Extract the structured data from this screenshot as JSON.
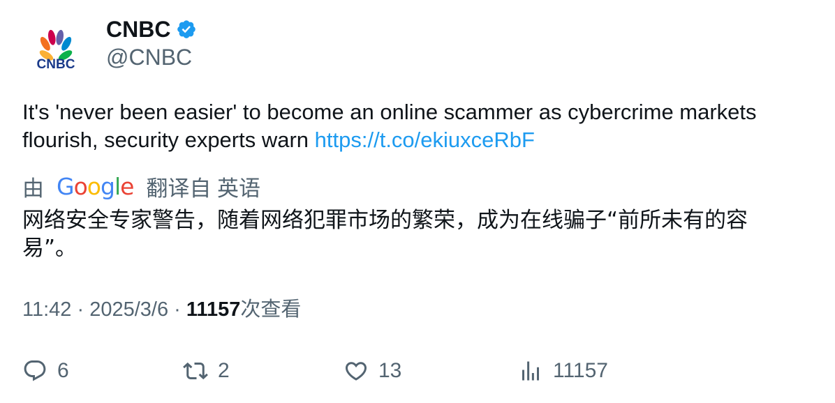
{
  "author": {
    "display_name": "CNBC",
    "handle": "@CNBC",
    "avatar_text": "CNBC",
    "verified": true,
    "avatar_colors": [
      "#fbb034",
      "#f37021",
      "#cc004c",
      "#6460aa",
      "#0089d0",
      "#0db14b"
    ]
  },
  "tweet": {
    "text": "It's 'never been easier' to become an online scammer as cybercrime markets flourish, security experts warn ",
    "link": "https://t.co/ekiuxceRbF"
  },
  "translation": {
    "prefix": "由",
    "provider": "Google",
    "suffix": "翻译自 英语",
    "text": "网络安全专家警告，随着网络犯罪市场的繁荣，成为在线骗子“前所未有的容易”。"
  },
  "meta": {
    "time": "11:42",
    "separator": "·",
    "date": "2025/3/6",
    "views_count": "11157",
    "views_label": "次查看"
  },
  "actions": {
    "replies": "6",
    "retweets": "2",
    "likes": "13",
    "views": "11157"
  },
  "colors": {
    "link": "#1d9bf0",
    "muted": "#536471",
    "verified": "#1d9bf0"
  }
}
